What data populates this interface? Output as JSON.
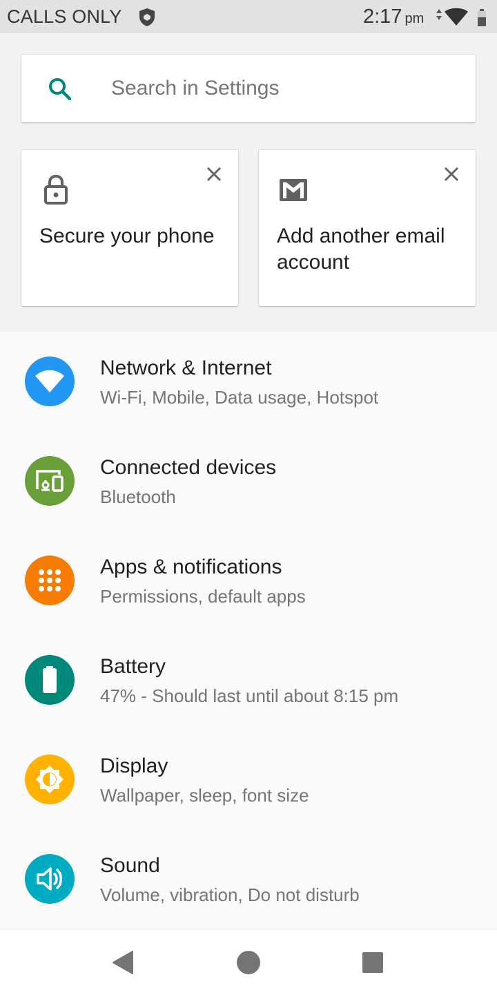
{
  "status_bar": {
    "carrier": "CALLS ONLY",
    "time": "2:17",
    "ampm": "pm"
  },
  "search": {
    "placeholder": "Search in Settings",
    "icon": "search-icon"
  },
  "suggestions": [
    {
      "label": "Secure your phone",
      "icon": "lock-icon"
    },
    {
      "label": "Add another email account",
      "icon": "gmail-icon"
    }
  ],
  "settings": [
    {
      "title": "Network & Internet",
      "subtitle": "Wi-Fi, Mobile, Data usage, Hotspot",
      "icon": "wifi-icon",
      "color": "#2196f3"
    },
    {
      "title": "Connected devices",
      "subtitle": "Bluetooth",
      "icon": "devices-icon",
      "color": "#689f38"
    },
    {
      "title": "Apps & notifications",
      "subtitle": "Permissions, default apps",
      "icon": "apps-icon",
      "color": "#f57c00"
    },
    {
      "title": "Battery",
      "subtitle": "47% - Should last until about 8:15 pm",
      "icon": "battery-icon",
      "color": "#00897b"
    },
    {
      "title": "Display",
      "subtitle": "Wallpaper, sleep, font size",
      "icon": "brightness-icon",
      "color": "#ffb300"
    },
    {
      "title": "Sound",
      "subtitle": "Volume, vibration, Do not disturb",
      "icon": "volume-icon",
      "color": "#00acc1"
    }
  ],
  "nav": [
    "back-icon",
    "home-icon",
    "recents-icon"
  ]
}
